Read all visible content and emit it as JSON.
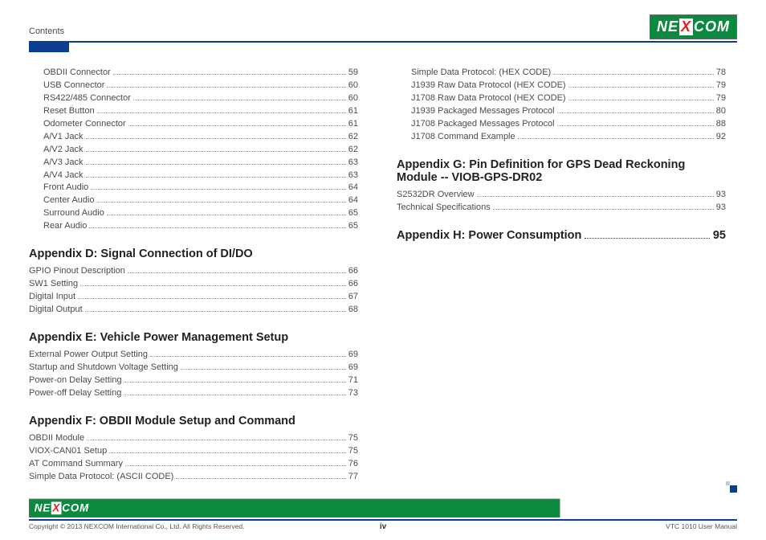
{
  "header": {
    "left": "Contents",
    "logo_pre": "NE",
    "logo_x": "X",
    "logo_post": "COM"
  },
  "col1": {
    "group1": [
      {
        "label": "OBDII Connector",
        "page": "59"
      },
      {
        "label": "USB Connector",
        "page": "60"
      },
      {
        "label": "RS422/485 Connector",
        "page": "60"
      },
      {
        "label": "Reset Button",
        "page": "61"
      },
      {
        "label": "Odometer Connector",
        "page": "61"
      },
      {
        "label": "A/V1 Jack",
        "page": "62"
      },
      {
        "label": "A/V2 Jack",
        "page": "62"
      },
      {
        "label": "A/V3 Jack",
        "page": "63"
      },
      {
        "label": "A/V4 Jack",
        "page": "63"
      },
      {
        "label": "Front Audio",
        "page": "64"
      },
      {
        "label": "Center Audio",
        "page": "64"
      },
      {
        "label": "Surround Audio",
        "page": "65"
      },
      {
        "label": "Rear Audio",
        "page": "65"
      }
    ],
    "appD_title": "Appendix D: Signal Connection of DI/DO",
    "appD": [
      {
        "label": "GPIO Pinout Description",
        "page": "66"
      },
      {
        "label": "SW1 Setting",
        "page": "66"
      },
      {
        "label": "Digital Input",
        "page": "67"
      },
      {
        "label": "Digital Output",
        "page": "68"
      }
    ],
    "appE_title": "Appendix E: Vehicle Power Management Setup",
    "appE": [
      {
        "label": "External Power Output Setting",
        "page": "69"
      },
      {
        "label": "Startup and Shutdown Voltage Setting",
        "page": "69"
      },
      {
        "label": "Power-on Delay Setting",
        "page": "71"
      },
      {
        "label": "Power-off Delay Setting",
        "page": "73"
      }
    ],
    "appF_title": "Appendix F: OBDII Module Setup and Command",
    "appF": [
      {
        "label": "OBDII Module",
        "page": "75"
      },
      {
        "label": "VIOX-CAN01 Setup",
        "page": "75"
      },
      {
        "label": "AT Command Summary",
        "page": "76"
      },
      {
        "label": "Simple Data Protocol: (ASCII CODE)",
        "page": "77"
      }
    ]
  },
  "col2": {
    "group1": [
      {
        "label": "Simple Data Protocol: (HEX CODE)",
        "page": "78"
      },
      {
        "label": "J1939 Raw Data Protocol (HEX CODE)",
        "page": "79"
      },
      {
        "label": "J1708 Raw Data Protocol (HEX CODE)",
        "page": "79"
      },
      {
        "label": "J1939 Packaged Messages Protocol",
        "page": "80"
      },
      {
        "label": "J1708 Packaged Messages Protocol",
        "page": "88"
      },
      {
        "label": "J1708 Command Example",
        "page": "92"
      }
    ],
    "appG_title": "Appendix G: Pin Definition for GPS Dead Reckoning Module -- VIOB-GPS-DR02",
    "appG": [
      {
        "label": "S2532DR Overview",
        "page": "93"
      },
      {
        "label": "Technical Specifications",
        "page": "93"
      }
    ],
    "appH_label": "Appendix H: Power Consumption",
    "appH_page": "95"
  },
  "footer": {
    "copyright": "Copyright © 2013 NEXCOM International Co., Ltd. All Rights Reserved.",
    "page": "iv",
    "manual": "VTC 1010 User Manual"
  }
}
